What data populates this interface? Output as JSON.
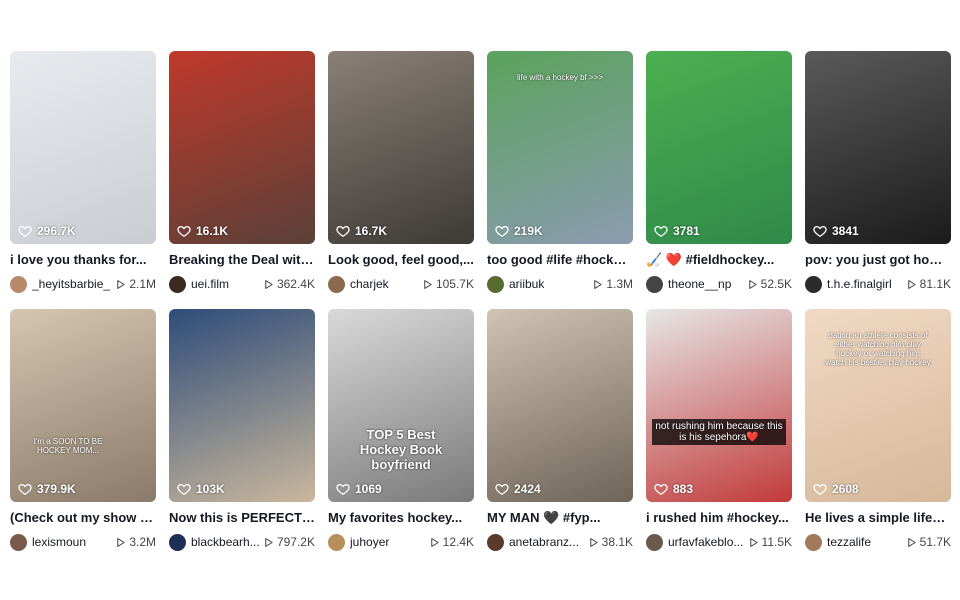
{
  "videos": [
    {
      "likes": "296.7K",
      "caption": "i love you thanks for...",
      "author": "_heyitsbarbie_",
      "views": "2.1M",
      "thumb_colors": [
        "#c9cdd2",
        "#e8ebee"
      ],
      "avatar_color": "#b98a6a"
    },
    {
      "likes": "16.1K",
      "caption": "Breaking the Deal with...",
      "author": "uei.film",
      "views": "362.4K",
      "thumb_colors": [
        "#5a4038",
        "#c0392b"
      ],
      "avatar_color": "#3a2a20"
    },
    {
      "likes": "16.7K",
      "caption": "Look good, feel good,...",
      "author": "charjek",
      "views": "105.7K",
      "thumb_colors": [
        "#3d3a36",
        "#8a8076"
      ],
      "avatar_color": "#8b6b50"
    },
    {
      "likes": "219K",
      "caption": "too good #life #hockey...",
      "author": "ariibuk",
      "views": "1.3M",
      "thumb_colors": [
        "#8b9bb0",
        "#5aa35c"
      ],
      "avatar_color": "#556b2f",
      "overlay": "life with a hockey bf >>>"
    },
    {
      "likes": "3781",
      "caption": "🏑 ❤️ #fieldhockey...",
      "author": "theone__np",
      "views": "52.5K",
      "thumb_colors": [
        "#2f8a4a",
        "#4caf50"
      ],
      "avatar_color": "#444"
    },
    {
      "likes": "3841",
      "caption": "pov: you just got home...",
      "author": "t.h.e.finalgirl",
      "views": "81.1K",
      "thumb_colors": [
        "#1b1b1b",
        "#5a5a5a"
      ],
      "avatar_color": "#2b2b2b"
    },
    {
      "likes": "379.9K",
      "caption": "(Check out my show ca...",
      "author": "lexismoun",
      "views": "3.2M",
      "thumb_colors": [
        "#8a7a6a",
        "#d4c6b0"
      ],
      "avatar_color": "#7a5a4a",
      "overlay": "I'm a SOON TO BE HOCKEY MOM..."
    },
    {
      "likes": "103K",
      "caption": "Now this is PERFECT!...",
      "author": "blackbearh...",
      "views": "797.2K",
      "thumb_colors": [
        "#c9b79c",
        "#2e4d7a"
      ],
      "avatar_color": "#1d2f55"
    },
    {
      "likes": "1069",
      "caption": "My favorites hockey...",
      "author": "juhoyer",
      "views": "12.4K",
      "thumb_colors": [
        "#7a7a7a",
        "#d9d9d9"
      ],
      "avatar_color": "#b78f5a",
      "overlay": "TOP 5 Best Hockey Book boyfriend"
    },
    {
      "likes": "2424",
      "caption": "MY MAN 🖤 #fyp...",
      "author": "anetabranz...",
      "views": "38.1K",
      "thumb_colors": [
        "#6e6458",
        "#cfc3b2"
      ],
      "avatar_color": "#5a3a2a"
    },
    {
      "likes": "883",
      "caption": "i rushed him #hockey...",
      "author": "urfavfakeblo...",
      "views": "11.5K",
      "thumb_colors": [
        "#c23a3a",
        "#e6e6e6"
      ],
      "avatar_color": "#6a5a4a",
      "overlay": "not rushing him because this is his sepehora❤️"
    },
    {
      "likes": "2608",
      "caption": "He lives a simple life✨...",
      "author": "tezzalife",
      "views": "51.7K",
      "thumb_colors": [
        "#d6b89a",
        "#f1d9c4"
      ],
      "avatar_color": "#a07a5a",
      "overlay": "dating an athlete consists of either watching him play hockey or watching him watch his besties play hockey"
    }
  ]
}
